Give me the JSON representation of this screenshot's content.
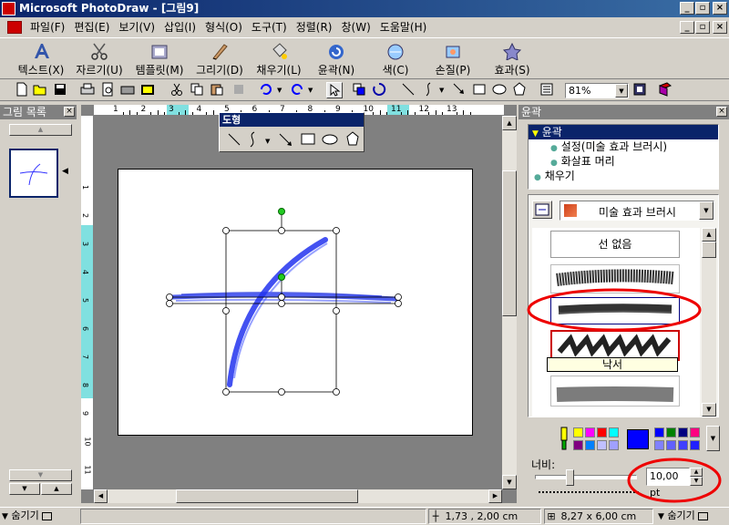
{
  "window": {
    "title": "Microsoft PhotoDraw - [그림9]"
  },
  "menu": [
    "파일(F)",
    "편집(E)",
    "보기(V)",
    "삽입(I)",
    "형식(O)",
    "도구(T)",
    "정렬(R)",
    "창(W)",
    "도움말(H)"
  ],
  "big_toolbar": [
    {
      "label": "텍스트(X)",
      "icon": "text-icon"
    },
    {
      "label": "자르기(U)",
      "icon": "scissors-icon"
    },
    {
      "label": "템플릿(M)",
      "icon": "template-icon"
    },
    {
      "label": "그리기(D)",
      "icon": "draw-icon"
    },
    {
      "label": "채우기(L)",
      "icon": "fill-icon"
    },
    {
      "label": "윤곽(N)",
      "icon": "outline-icon"
    },
    {
      "label": "색(C)",
      "icon": "color-icon"
    },
    {
      "label": "손질(P)",
      "icon": "touchup-icon"
    },
    {
      "label": "효과(S)",
      "icon": "effects-icon"
    }
  ],
  "zoom": "81%",
  "picture_list": {
    "title": "그림 목록"
  },
  "shape_toolbar": {
    "title": "도형"
  },
  "ruler_labels": [
    "1",
    "2",
    "3",
    "4",
    "5",
    "6",
    "7",
    "8",
    "9",
    "10",
    "11",
    "12",
    "13"
  ],
  "vruler_labels": [
    "1",
    "2",
    "3",
    "4",
    "5",
    "6",
    "7",
    "8",
    "9",
    "10",
    "11"
  ],
  "outline_panel": {
    "title": "윤곽",
    "tree": {
      "root": "윤곽",
      "child1": "설정(미술 효과 브러시)",
      "child2": "화살표 머리",
      "sibling": "채우기"
    },
    "dropdown": "미술 효과 브러시",
    "brushes": {
      "none": "선 없음",
      "tooltip": "낙서"
    },
    "width_label": "너비:",
    "width_value": "10,00 pt"
  },
  "palette": {
    "colors": [
      "#ffff00",
      "#ff00ff",
      "#ff0000",
      "#00ffff",
      "#0000ff",
      "#008000",
      "#000080",
      "#ff0080",
      "#800080",
      "#0080ff",
      "#c0c0ff",
      "#a0a0ff",
      "#8080ff",
      "#6060ff",
      "#4040ff",
      "#2020ff"
    ],
    "current": "#0000ff"
  },
  "status": {
    "hide_left": "숨기기",
    "position": "1,73 , 2,00 cm",
    "size": "8,27 x 6,00 cm",
    "hide_right": "숨기기"
  }
}
